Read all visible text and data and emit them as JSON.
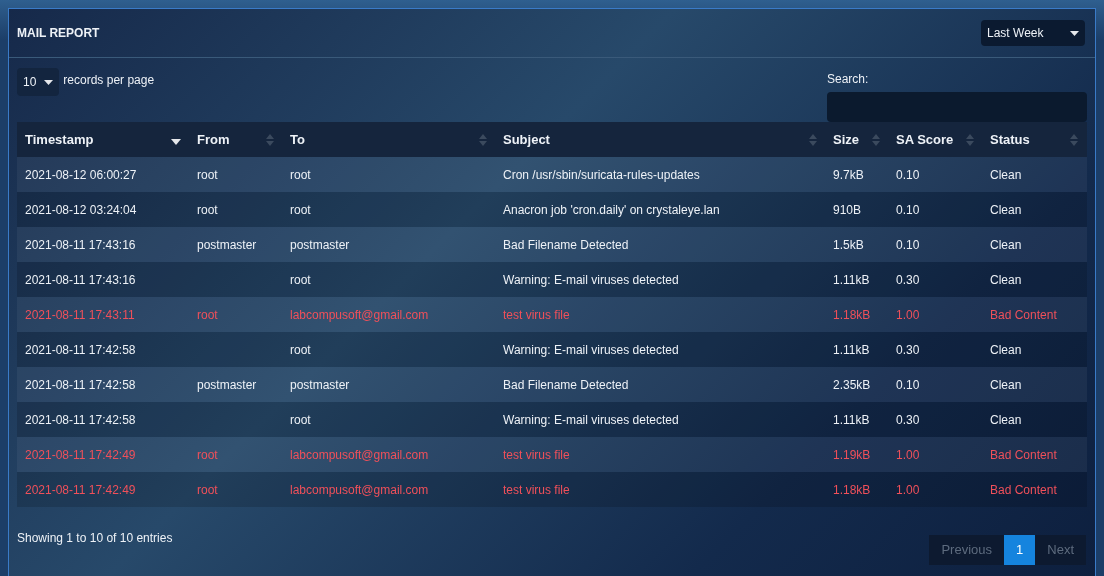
{
  "panel": {
    "title": "MAIL REPORT",
    "period": "Last Week"
  },
  "length": {
    "value": "10",
    "label": "records per page"
  },
  "search": {
    "label": "Search:"
  },
  "table": {
    "columns": [
      {
        "label": "Timestamp",
        "sorted": true
      },
      {
        "label": "From",
        "sorted": false
      },
      {
        "label": "To",
        "sorted": false
      },
      {
        "label": "Subject",
        "sorted": false
      },
      {
        "label": "Size",
        "sorted": false
      },
      {
        "label": "SA Score",
        "sorted": false
      },
      {
        "label": "Status",
        "sorted": false
      }
    ],
    "rows": [
      {
        "flagged": false,
        "cells": [
          "2021-08-12 06:00:27",
          "root",
          "root",
          "Cron /usr/sbin/suricata-rules-updates",
          "9.7kB",
          "0.10",
          "Clean"
        ]
      },
      {
        "flagged": false,
        "cells": [
          "2021-08-12 03:24:04",
          "root",
          "root",
          "Anacron job 'cron.daily' on crystaleye.lan",
          "910B",
          "0.10",
          "Clean"
        ]
      },
      {
        "flagged": false,
        "cells": [
          "2021-08-11 17:43:16",
          "postmaster",
          "postmaster",
          "Bad Filename Detected",
          "1.5kB",
          "0.10",
          "Clean"
        ]
      },
      {
        "flagged": false,
        "cells": [
          "2021-08-11 17:43:16",
          "",
          "root",
          "Warning: E-mail viruses detected",
          "1.11kB",
          "0.30",
          "Clean"
        ]
      },
      {
        "flagged": true,
        "cells": [
          "2021-08-11 17:43:11",
          "root",
          "labcompusoft@gmail.com",
          "test virus file",
          "1.18kB",
          "1.00",
          "Bad Content"
        ]
      },
      {
        "flagged": false,
        "cells": [
          "2021-08-11 17:42:58",
          "",
          "root",
          "Warning: E-mail viruses detected",
          "1.11kB",
          "0.30",
          "Clean"
        ]
      },
      {
        "flagged": false,
        "cells": [
          "2021-08-11 17:42:58",
          "postmaster",
          "postmaster",
          "Bad Filename Detected",
          "2.35kB",
          "0.10",
          "Clean"
        ]
      },
      {
        "flagged": false,
        "cells": [
          "2021-08-11 17:42:58",
          "",
          "root",
          "Warning: E-mail viruses detected",
          "1.11kB",
          "0.30",
          "Clean"
        ]
      },
      {
        "flagged": true,
        "cells": [
          "2021-08-11 17:42:49",
          "root",
          "labcompusoft@gmail.com",
          "test virus file",
          "1.19kB",
          "1.00",
          "Bad Content"
        ]
      },
      {
        "flagged": true,
        "cells": [
          "2021-08-11 17:42:49",
          "root",
          "labcompusoft@gmail.com",
          "test virus file",
          "1.18kB",
          "1.00",
          "Bad Content"
        ]
      }
    ]
  },
  "info": "Showing 1 to 10 of 10 entries",
  "pagination": [
    {
      "label": "Previous",
      "selected": false,
      "disabled": true
    },
    {
      "label": "1",
      "selected": true
    },
    {
      "label": "Next",
      "selected": false,
      "disabled": true
    }
  ]
}
